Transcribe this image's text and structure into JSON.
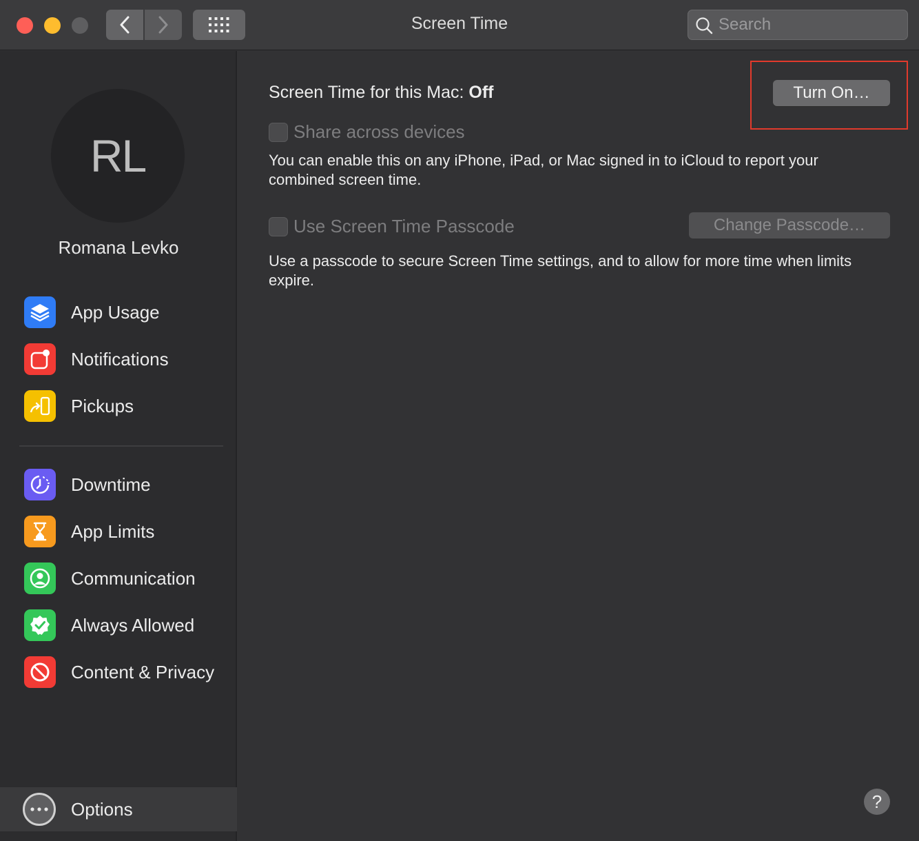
{
  "window": {
    "title": "Screen Time",
    "search_placeholder": "Search"
  },
  "user": {
    "initials": "RL",
    "name": "Romana Levko"
  },
  "sidebar": {
    "reports": [
      {
        "label": "App Usage",
        "icon": "layers-icon",
        "color": "#2f7cf6"
      },
      {
        "label": "Notifications",
        "icon": "notification-badge-icon",
        "color": "#f23b35"
      },
      {
        "label": "Pickups",
        "icon": "pickup-phone-icon",
        "color": "#f5c000"
      }
    ],
    "settings": [
      {
        "label": "Downtime",
        "icon": "moon-clock-icon",
        "color": "#6a5cf2"
      },
      {
        "label": "App Limits",
        "icon": "hourglass-icon",
        "color": "#f79a1e"
      },
      {
        "label": "Communication",
        "icon": "person-circle-icon",
        "color": "#34c759"
      },
      {
        "label": "Always Allowed",
        "icon": "checkmark-badge-icon",
        "color": "#34c759"
      },
      {
        "label": "Content & Privacy",
        "icon": "no-entry-icon",
        "color": "#f23b35"
      }
    ],
    "options_label": "Options"
  },
  "main": {
    "status_prefix": "Screen Time for this Mac: ",
    "status_value": "Off",
    "turn_on_label": "Turn On…",
    "share_label": "Share across devices",
    "share_desc": "You can enable this on any iPhone, iPad, or Mac signed in to iCloud to report your combined screen time.",
    "passcode_label": "Use Screen Time Passcode",
    "change_passcode_label": "Change Passcode…",
    "passcode_desc": "Use a passcode to secure Screen Time settings, and to allow for more time when limits expire.",
    "help_label": "?"
  }
}
